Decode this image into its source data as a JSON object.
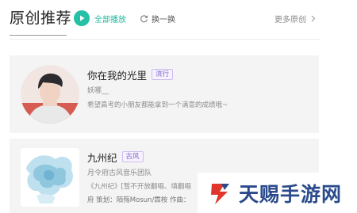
{
  "header": {
    "title": "原创推荐",
    "play_all_label": "全部播放",
    "refresh_label": "换一换",
    "more_label": "更多原创"
  },
  "cards": [
    {
      "song": "你在我的光里",
      "tag": "流行",
      "artist": "妖哪__",
      "description": "希望高考的小朋友都能拿到一个满意的成绩哦~"
    },
    {
      "song": "九州纪",
      "tag": "古风",
      "artist": "月令府古风音乐团队",
      "description": "《九州纪》[暂不开放翻唱、填翻唱",
      "credits": "府 策划：陌殇Mosun/霖桉 作曲："
    }
  ],
  "watermark": {
    "text": "天赐手游网"
  },
  "colors": {
    "accent": "#26c0a6",
    "tag_purple": "#7f63c8",
    "card_bg": "#f4f4f4",
    "watermark_blue": "#2b4a8c",
    "watermark_red": "#e0362c"
  },
  "icons": {
    "play": "play-icon",
    "refresh": "refresh-icon",
    "more": "chevron-right-icon"
  }
}
